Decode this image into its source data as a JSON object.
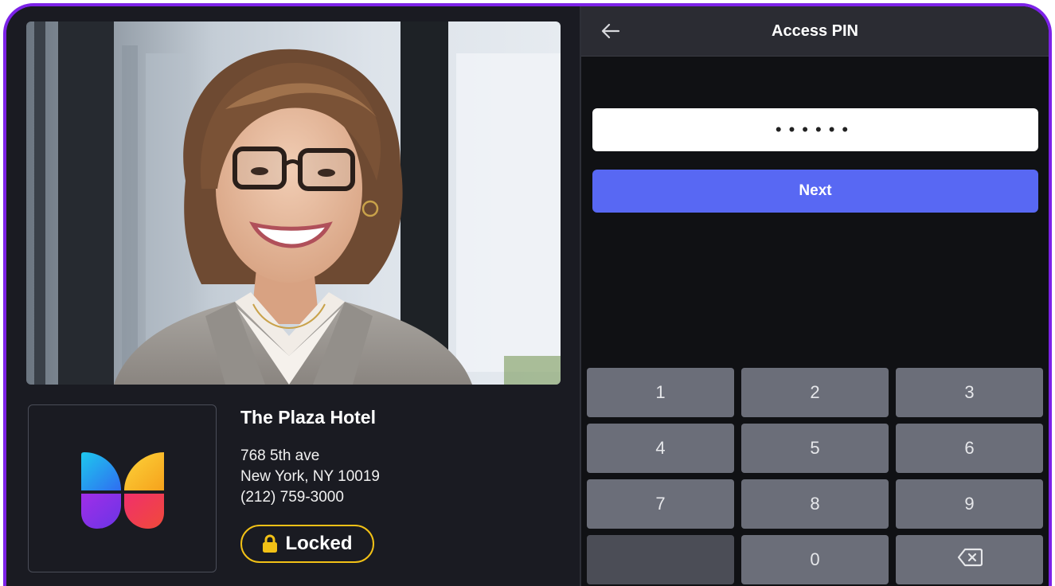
{
  "header": {
    "title": "Access PIN",
    "back_icon": "arrow-left-icon"
  },
  "pin": {
    "value": "••••••",
    "digits_entered": 6
  },
  "next_label": "Next",
  "keypad": {
    "keys": [
      "1",
      "2",
      "3",
      "4",
      "5",
      "6",
      "7",
      "8",
      "9",
      "",
      "0",
      "⌫"
    ],
    "backspace_icon": "backspace-icon"
  },
  "location": {
    "name": "The Plaza Hotel",
    "address_line1": "768 5th ave",
    "address_line2": "New York, NY 10019",
    "phone": "(212) 759-3000"
  },
  "status": {
    "label": "Locked",
    "icon": "lock-icon",
    "color": "#f2c116"
  },
  "colors": {
    "accent_frame": "#7c22e8",
    "button_primary": "#5868f3",
    "keypad_key": "#6b6e79",
    "panel_bg": "#1a1b22",
    "right_bg": "#101114"
  },
  "logo": {
    "icon": "butterfly-logo-icon"
  },
  "photo": {
    "subject": "smiling woman with glasses portrait"
  }
}
